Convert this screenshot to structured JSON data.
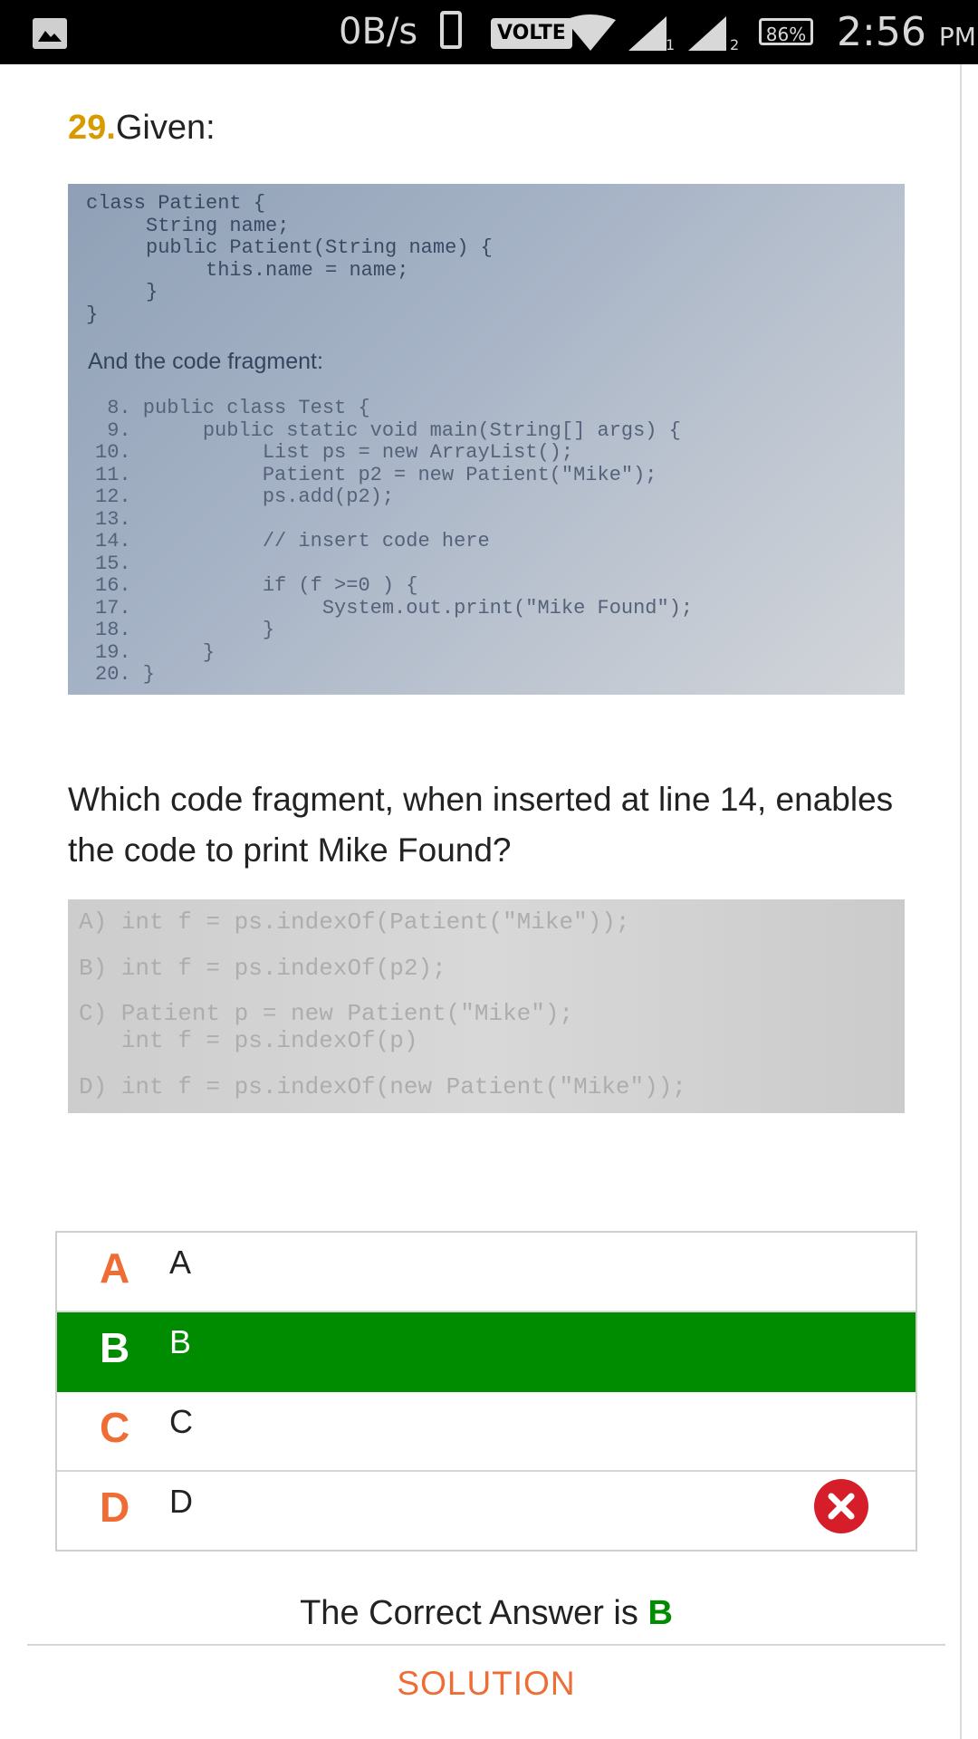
{
  "status_bar": {
    "net_speed": "0B/s",
    "volte": "VOLTE",
    "sim1": "1",
    "sim2": "2",
    "battery": "86%",
    "time": "2:56",
    "ampm": "PM"
  },
  "question": {
    "number": "29.",
    "given": "Given:",
    "code_image": {
      "class_code": "class Patient {\n     String name;\n     public Patient(String name) {\n          this.name = name;\n     }\n}",
      "fragment_label": "And the code fragment:",
      "fragment_code": " 8. public class Test {\n 9.      public static void main(String[] args) {\n10.           List ps = new ArrayList();\n11.           Patient p2 = new Patient(\"Mike\");\n12.           ps.add(p2);\n13.\n14.           // insert code here\n15.\n16.           if (f >=0 ) {\n17.                System.out.print(\"Mike Found\");\n18.           }\n19.      }\n20. }"
    },
    "text": "Which code fragment, when inserted at line 14, enables the code to print Mike Found?",
    "options_image": {
      "a": "A) int f = ps.indexOf(Patient(\"Mike\"));",
      "b": "B) int f = ps.indexOf(p2);",
      "c": "C) Patient p = new Patient(\"Mike\");\n   int f = ps.indexOf(p)",
      "d": "D) int f = ps.indexOf(new Patient(\"Mike\"));"
    }
  },
  "choices": [
    {
      "letter": "A",
      "text": "A"
    },
    {
      "letter": "B",
      "text": "B"
    },
    {
      "letter": "C",
      "text": "C"
    },
    {
      "letter": "D",
      "text": "D"
    }
  ],
  "result": {
    "prefix": "The Correct Answer is",
    "answer": "B"
  },
  "solution_label": "SOLUTION",
  "colors": {
    "accent": "#ef6c35",
    "question_number": "#d79b00",
    "correct": "#008c00",
    "wrong": "#d51e2a"
  },
  "icons": [
    "gallery-icon",
    "phone-icon",
    "wifi-icon",
    "signal-icon",
    "battery-icon",
    "wrong-answer-icon"
  ]
}
